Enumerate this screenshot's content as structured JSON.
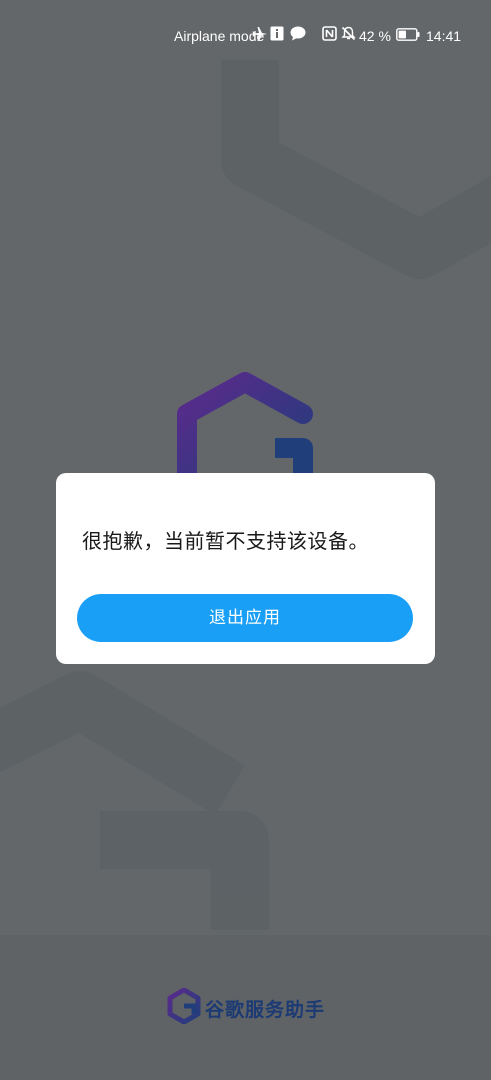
{
  "status_bar": {
    "airplane_mode_label": "Airplane mode",
    "battery_percent": "42 %",
    "time": "14:41",
    "icons": [
      "airplane-icon",
      "info-icon",
      "message-icon",
      "nfc-icon",
      "mute-icon",
      "battery-icon"
    ]
  },
  "dialog": {
    "message": "很抱歉，当前暂不支持该设备。",
    "exit_button_label": "退出应用"
  },
  "footer": {
    "app_name": "谷歌服务助手"
  },
  "colors": {
    "background": "#646769",
    "dialog_bg": "#ffffff",
    "button_accent": "#1a9ff7",
    "brand_text": "#1c3a73",
    "logo_gradient_start": "#5b2a8c",
    "logo_gradient_end": "#1f3e7a"
  }
}
